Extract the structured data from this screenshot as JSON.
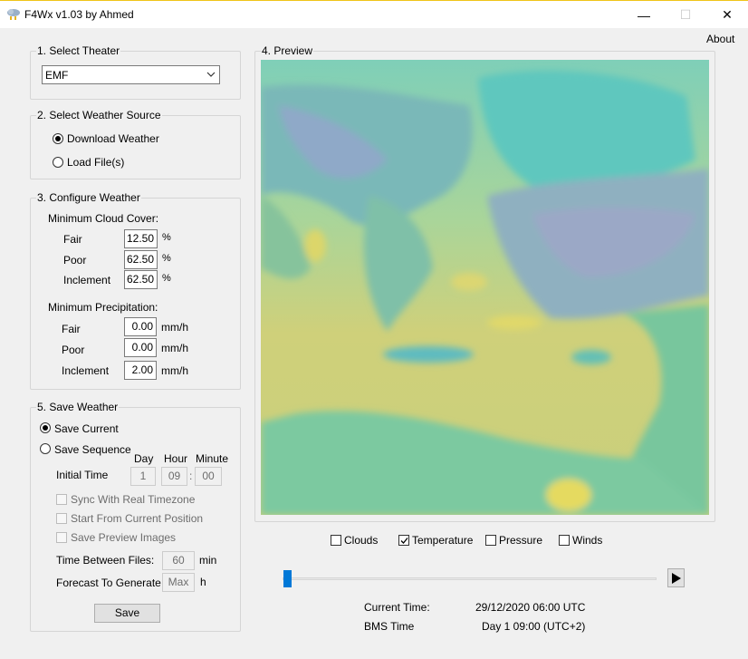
{
  "window": {
    "title": "F4Wx v1.03 by Ahmed",
    "minimize_glyph": "—",
    "maximize_glyph": "☐",
    "close_glyph": "✕"
  },
  "menu": {
    "about": "About"
  },
  "theater": {
    "legend": "1. Select Theater",
    "selected": "EMF"
  },
  "source": {
    "legend": "2. Select Weather Source",
    "options": [
      "Download Weather",
      "Load File(s)"
    ],
    "selected": 0
  },
  "configure": {
    "legend": "3. Configure Weather",
    "cloud_title": "Minimum Cloud Cover:",
    "cloud_rows": [
      {
        "label": "Fair",
        "value": "12.50",
        "unit": "%"
      },
      {
        "label": "Poor",
        "value": "62.50",
        "unit": "%"
      },
      {
        "label": "Inclement",
        "value": "62.50",
        "unit": "%"
      }
    ],
    "precip_title": "Minimum Precipitation:",
    "precip_rows": [
      {
        "label": "Fair",
        "value": "0.00",
        "unit": "mm/h"
      },
      {
        "label": "Poor",
        "value": "0.00",
        "unit": "mm/h"
      },
      {
        "label": "Inclement",
        "value": "2.00",
        "unit": "mm/h"
      }
    ]
  },
  "save": {
    "legend": "5. Save Weather",
    "options": [
      "Save Current",
      "Save Sequence"
    ],
    "selected": 0,
    "col_day": "Day",
    "col_hour": "Hour",
    "col_minute": "Minute",
    "initial_time_label": "Initial Time",
    "day": "1",
    "hour": "09",
    "minute": "00",
    "separator": ":",
    "checks": [
      "Sync With Real Timezone",
      "Start From Current Position",
      "Save Preview Images"
    ],
    "between_label": "Time Between Files:",
    "between_value": "60",
    "between_unit": "min",
    "forecast_label": "Forecast To Generate",
    "forecast_value": "Max",
    "forecast_unit": "h",
    "button": "Save"
  },
  "preview": {
    "legend": "4. Preview",
    "layers": [
      {
        "label": "Clouds",
        "checked": false
      },
      {
        "label": "Temperature",
        "checked": true
      },
      {
        "label": "Pressure",
        "checked": false
      },
      {
        "label": "Winds",
        "checked": false
      }
    ],
    "timeline_position": 0
  },
  "status": {
    "current_label": "Current Time:",
    "current_value": "29/12/2020 06:00 UTC",
    "bms_label": "BMS Time",
    "bms_value": "Day 1 09:00 (UTC+2)"
  },
  "colors": {
    "sea_warm": "#cfd07a",
    "sea_cool": "#7fcfb8",
    "land_green": "#82c496",
    "land_cool": "#5fb3bd",
    "highlight": "#e0d86a",
    "accent": "#0078d7"
  }
}
